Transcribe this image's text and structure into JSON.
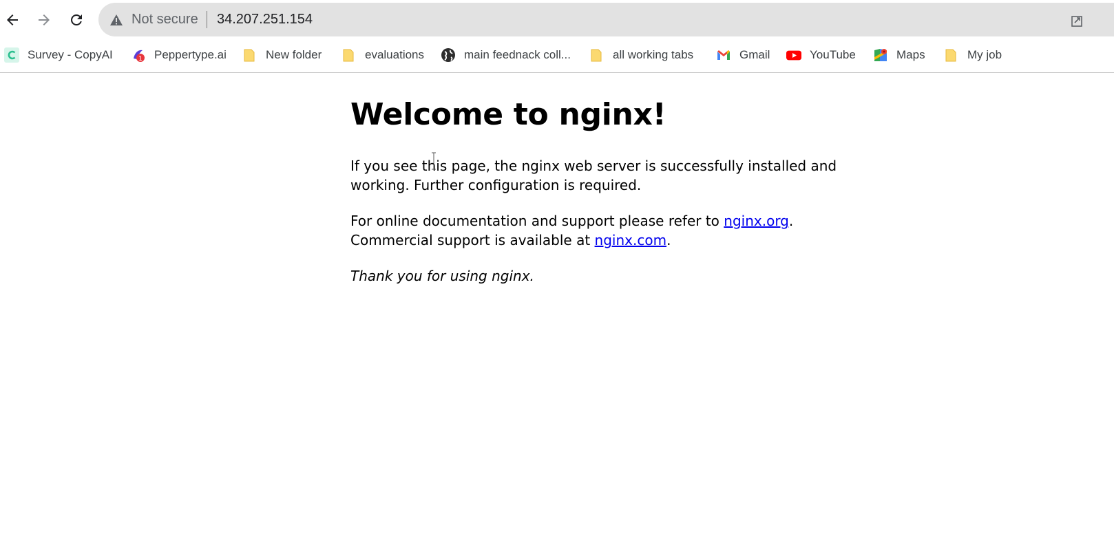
{
  "browser": {
    "security_label": "Not secure",
    "url": "34.207.251.154"
  },
  "bookmarks": [
    {
      "label": "Survey - CopyAI",
      "icon": "copyai-icon"
    },
    {
      "label": "Peppertype.ai",
      "icon": "peppertype-icon"
    },
    {
      "label": "New folder",
      "icon": "folder-icon"
    },
    {
      "label": "evaluations",
      "icon": "folder-icon"
    },
    {
      "label": "main feednack coll...",
      "icon": "globe-icon"
    },
    {
      "label": "all working tabs",
      "icon": "folder-icon"
    },
    {
      "label": "Gmail",
      "icon": "gmail-icon"
    },
    {
      "label": "YouTube",
      "icon": "youtube-icon"
    },
    {
      "label": "Maps",
      "icon": "maps-icon"
    },
    {
      "label": "My job",
      "icon": "folder-icon"
    }
  ],
  "page": {
    "title": "Welcome to nginx!",
    "para1": "If you see this page, the nginx web server is successfully installed and working. Further configuration is required.",
    "para2_a": "For online documentation and support please refer to ",
    "link_org": "nginx.org",
    "para2_b": ".",
    "para2_c": "Commercial support is available at ",
    "link_com": "nginx.com",
    "para2_d": ".",
    "thanks": "Thank you for using nginx."
  },
  "colors": {
    "link": "#0000ee",
    "omnibox_bg": "#e2e2e2"
  }
}
